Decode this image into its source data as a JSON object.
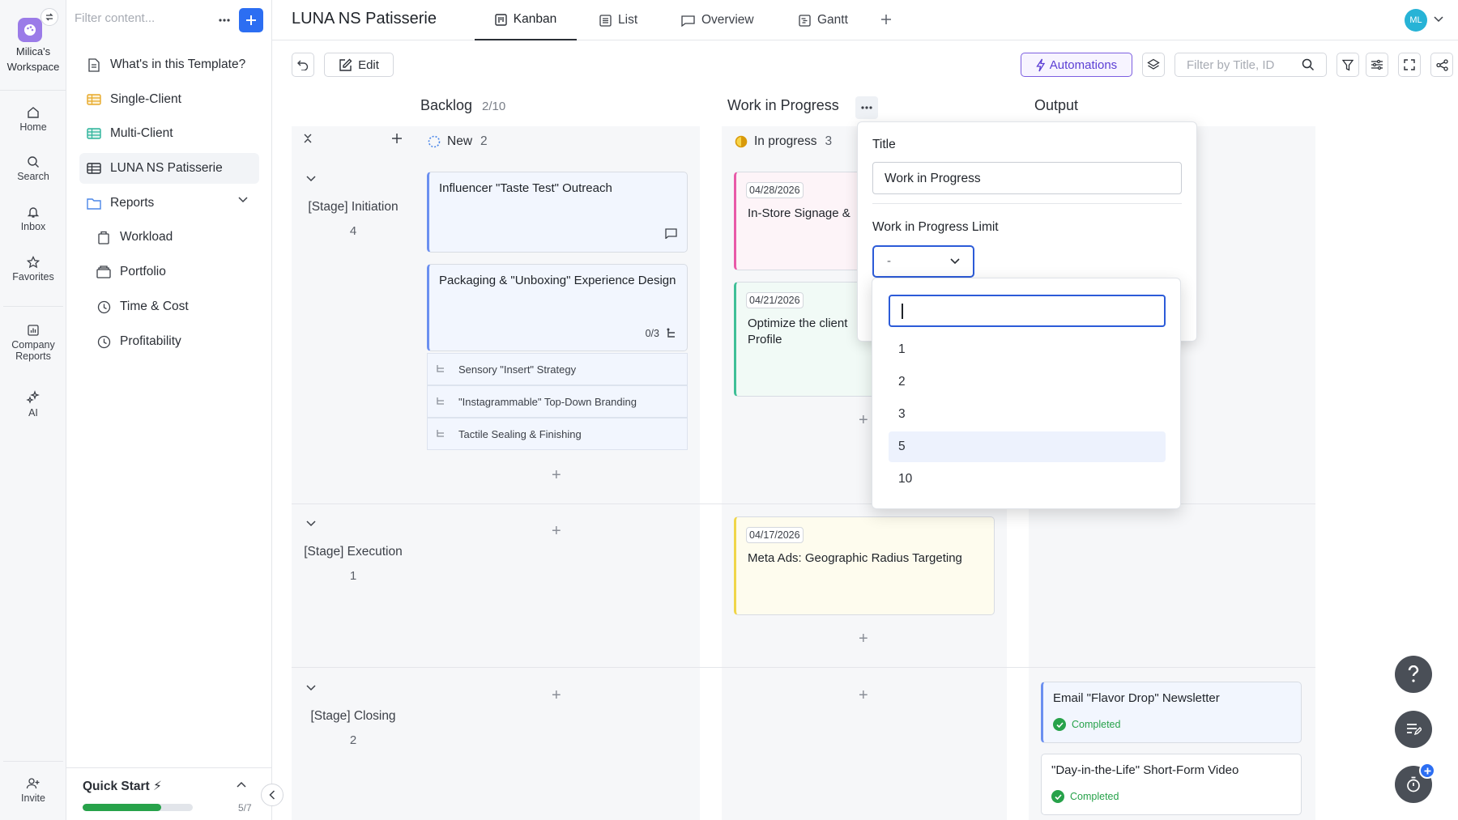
{
  "workspace": {
    "name_line1": "Milica's",
    "name_line2": "Workspace"
  },
  "rail": {
    "home": "Home",
    "search": "Search",
    "inbox": "Inbox",
    "favorites": "Favorites",
    "company_reports_line1": "Company",
    "company_reports_line2": "Reports",
    "ai": "AI",
    "invite": "Invite"
  },
  "sidebar": {
    "filter_placeholder": "Filter content...",
    "items": [
      {
        "label": "What's in this Template?",
        "icon": "document-icon"
      },
      {
        "label": "Single-Client",
        "icon": "table-yellow-icon"
      },
      {
        "label": "Multi-Client",
        "icon": "table-green-icon"
      },
      {
        "label": "LUNA NS Patisserie",
        "icon": "table-icon",
        "selected": true
      },
      {
        "label": "Reports",
        "icon": "folder-icon"
      },
      {
        "label": "Workload",
        "icon": "workload-icon"
      },
      {
        "label": "Portfolio",
        "icon": "portfolio-icon"
      },
      {
        "label": "Time & Cost",
        "icon": "clock-icon"
      },
      {
        "label": "Profitability",
        "icon": "clock-icon"
      }
    ],
    "quick_start": {
      "label": "Quick Start ⚡",
      "progress": "5/7",
      "fraction": 0.714
    }
  },
  "header": {
    "project_title": "LUNA NS Patisserie",
    "tabs": [
      "Kanban",
      "List",
      "Overview",
      "Gantt"
    ],
    "active_tab": "Kanban",
    "avatar": "ML"
  },
  "toolbar": {
    "edit": "Edit",
    "automations": "Automations",
    "filter_placeholder": "Filter by Title, ID"
  },
  "board": {
    "columns": [
      {
        "title": "Backlog",
        "count": "2/10"
      },
      {
        "title": "Work in Progress"
      },
      {
        "title": "Output"
      }
    ],
    "statuses": [
      {
        "label": "New",
        "count": "2"
      },
      {
        "label": "In progress",
        "count": "3"
      }
    ],
    "stages": [
      {
        "label": "[Stage] Initiation",
        "count": "4"
      },
      {
        "label": "[Stage] Execution",
        "count": "1"
      },
      {
        "label": "[Stage] Closing",
        "count": "2"
      }
    ],
    "cards": {
      "influencer": "Influencer \"Taste Test\" Outreach",
      "packaging": "Packaging & \"Unboxing\" Experience Design",
      "packaging_subtasks": "0/3",
      "subtasks": [
        "Sensory \"Insert\" Strategy",
        "\"Instagrammable\" Top-Down Branding",
        "Tactile Sealing & Finishing"
      ],
      "signage_date": "04/28/2026",
      "signage_title": "In-Store Signage &",
      "optimize_date": "04/21/2026",
      "optimize_title_line1": "Optimize the client",
      "optimize_title_line2": "Profile",
      "meta_date": "04/17/2026",
      "meta_title": "Meta Ads: Geographic Radius Targeting",
      "email_title": "Email \"Flavor Drop\" Newsletter",
      "email_status": "Completed",
      "day_title": "\"Day-in-the-Life\" Short-Form Video",
      "day_status": "Completed"
    }
  },
  "popover": {
    "title_label": "Title",
    "title_value": "Work in Progress",
    "limit_label": "Work in Progress Limit",
    "limit_value": "-",
    "options": [
      "1",
      "2",
      "3",
      "5",
      "10"
    ],
    "highlighted_option": "5"
  },
  "colors": {
    "accent": "#2c6ef2",
    "automations": "#5b3ed4",
    "completed": "#27a24a",
    "card_blue": "#f2f6fe"
  }
}
